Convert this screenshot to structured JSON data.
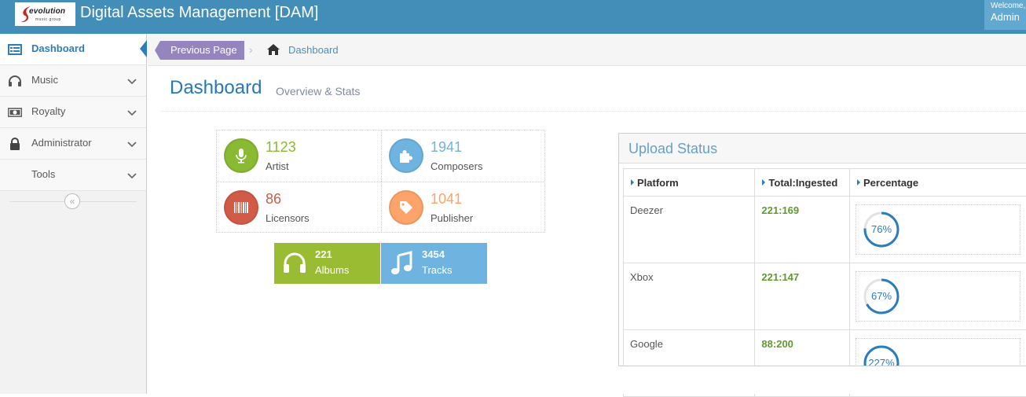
{
  "app": {
    "logo_text": "evolution",
    "logo_sub": "music group",
    "title": "Digital Assets Management [DAM]",
    "user_welcome": "Welcome,",
    "user_name": "Admin"
  },
  "sidebar": {
    "items": [
      {
        "label": "Dashboard",
        "icon": "dashboard-icon",
        "active": true
      },
      {
        "label": "Music",
        "icon": "headphones-icon"
      },
      {
        "label": "Royalty",
        "icon": "money-icon"
      },
      {
        "label": "Administrator",
        "icon": "lock-icon"
      },
      {
        "label": "Tools",
        "icon": ""
      }
    ],
    "collapse_glyph": "«"
  },
  "breadcrumbs": {
    "previous_label": "Previous Page",
    "separator": "›",
    "current": "Dashboard"
  },
  "header": {
    "title": "Dashboard",
    "subtitle": "Overview & Stats"
  },
  "stats": [
    {
      "value": "1123",
      "label": "Artist",
      "color": "#8ab933",
      "icon": "microphone-icon"
    },
    {
      "value": "1941",
      "label": "Composers",
      "color": "#6fb3e0",
      "icon": "puzzle-icon"
    },
    {
      "value": "86",
      "label": "Licensors",
      "color": "#d15b47",
      "icon": "barcode-icon"
    },
    {
      "value": "1041",
      "label": "Publisher",
      "color": "#fea36a",
      "icon": "tag-icon"
    }
  ],
  "tiles": [
    {
      "value": "221",
      "label": "Albums",
      "color": "#9abc32",
      "icon": "headphones-icon"
    },
    {
      "value": "3454",
      "label": "Tracks",
      "color": "#6fb3e0",
      "icon": "music-note-icon"
    }
  ],
  "upload_status": {
    "title": "Upload Status",
    "columns": [
      "Platform",
      "Total:Ingested",
      "Percentage"
    ],
    "rows": [
      {
        "platform": "Deezer",
        "counts": "221:169",
        "percent_label": "76%",
        "percent": 76
      },
      {
        "platform": "Xbox",
        "counts": "221:147",
        "percent_label": "67%",
        "percent": 67
      },
      {
        "platform": "Google",
        "counts": "88:200",
        "percent_label": "227%",
        "percent": 227
      }
    ]
  }
}
